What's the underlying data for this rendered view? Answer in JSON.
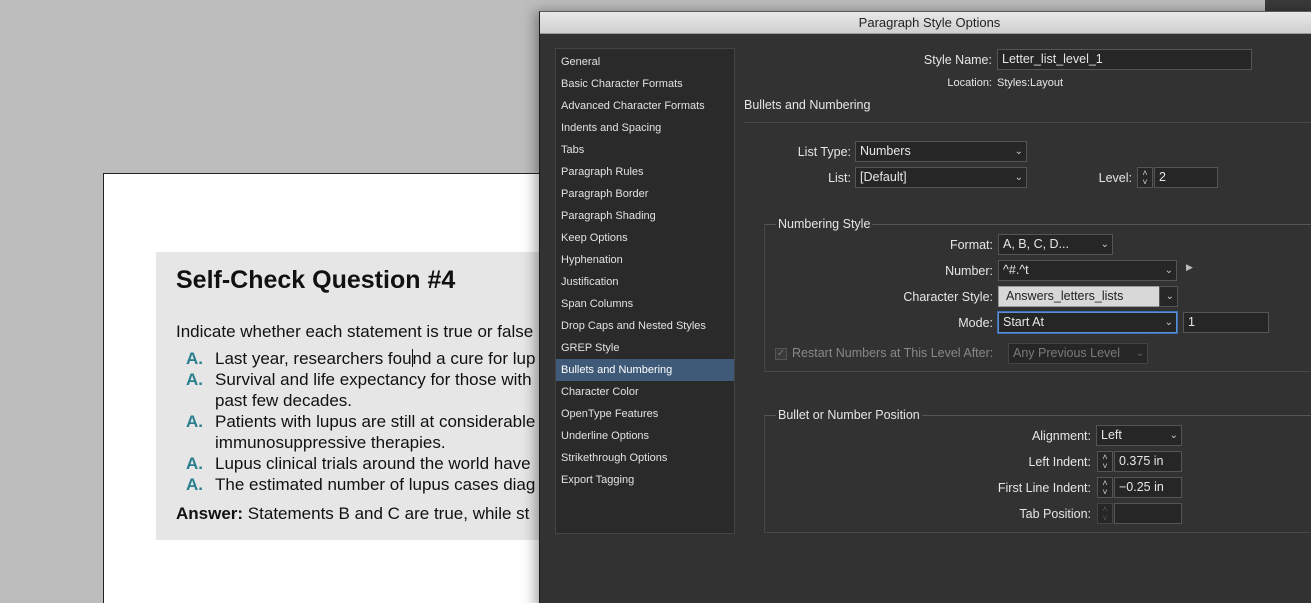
{
  "document": {
    "title": "Self-Check Question #4",
    "intro": "Indicate whether each statement is true or false",
    "items": [
      {
        "letter": "A.",
        "lines": [
          "Last year, researchers found a cure for lup"
        ]
      },
      {
        "letter": "A.",
        "lines": [
          "Survival and life expectancy for those with",
          "past few decades."
        ]
      },
      {
        "letter": "A.",
        "lines": [
          "Patients with lupus are still at considerable",
          "immunosuppressive therapies."
        ]
      },
      {
        "letter": "A.",
        "lines": [
          "Lupus clinical trials around the world have"
        ]
      },
      {
        "letter": "A.",
        "lines": [
          "The estimated number of lupus cases diag"
        ]
      }
    ],
    "answer_label": "Answer:",
    "answer_text": " Statements B and C are true, while st",
    "letter_color": "#2a7f8f"
  },
  "dialog": {
    "title": "Paragraph Style Options",
    "sidebar": [
      "General",
      "Basic Character Formats",
      "Advanced Character Formats",
      "Indents and Spacing",
      "Tabs",
      "Paragraph Rules",
      "Paragraph Border",
      "Paragraph Shading",
      "Keep Options",
      "Hyphenation",
      "Justification",
      "Span Columns",
      "Drop Caps and Nested Styles",
      "GREP Style",
      "Bullets and Numbering",
      "Character Color",
      "OpenType Features",
      "Underline Options",
      "Strikethrough Options",
      "Export Tagging"
    ],
    "selected_index": 14,
    "style_name_label": "Style Name:",
    "style_name_value": "Letter_list_level_1",
    "location_label": "Location:",
    "location_value": "Styles:Layout",
    "section_title": "Bullets and Numbering",
    "list_type_label": "List Type:",
    "list_type_value": "Numbers",
    "list_label": "List:",
    "list_value": "[Default]",
    "level_label": "Level:",
    "level_value": "2",
    "numbering_style": {
      "title": "Numbering Style",
      "format_label": "Format:",
      "format_value": "A, B, C, D...",
      "number_label": "Number:",
      "number_value": "^#.^t",
      "char_style_label": "Character Style:",
      "char_style_value": "Answers_letters_lists",
      "mode_label": "Mode:",
      "mode_value": "Start At",
      "start_value": "1",
      "restart_label": "Restart Numbers at This Level After:",
      "restart_value": "Any Previous Level"
    },
    "position": {
      "title": "Bullet or Number Position",
      "alignment_label": "Alignment:",
      "alignment_value": "Left",
      "left_indent_label": "Left Indent:",
      "left_indent_value": "0.375 in",
      "first_line_label": "First Line Indent:",
      "first_line_value": "−0.25 in",
      "tab_position_label": "Tab Position:",
      "tab_position_value": ""
    },
    "icons": {
      "dropdown": "chevron-down-icon",
      "spinner": "spin-arrows-icon",
      "flyout": "triangle-right-icon",
      "checkbox": "checkmark-icon"
    }
  }
}
